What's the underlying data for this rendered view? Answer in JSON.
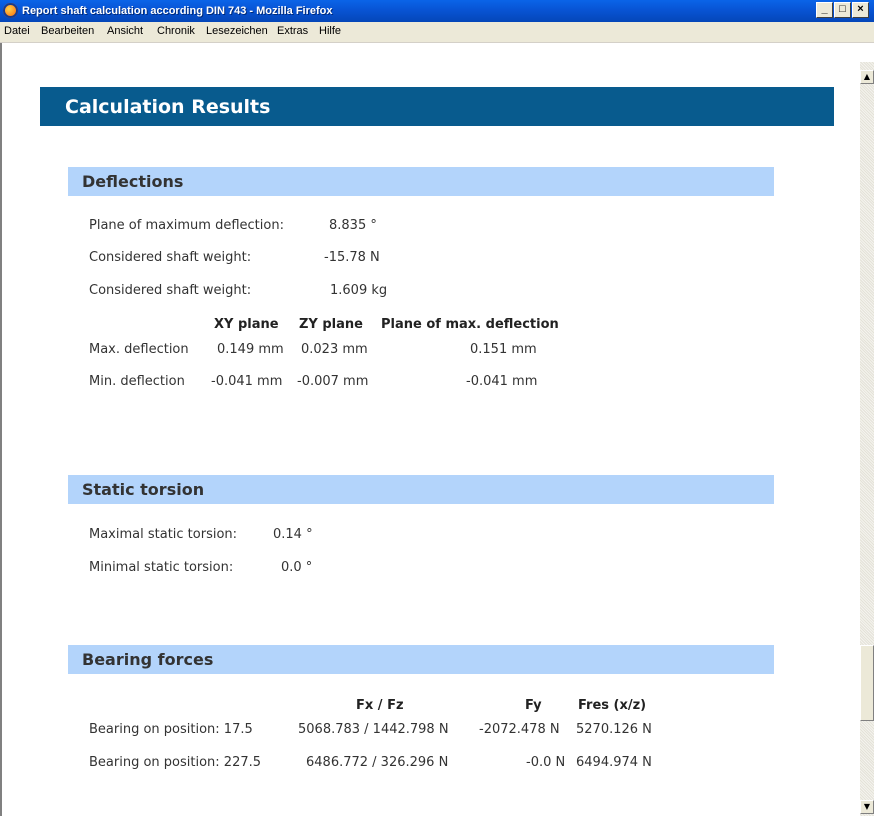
{
  "window": {
    "title": "Report shaft calculation according DIN 743 - Mozilla Firefox",
    "minimize_label": "_",
    "maximize_label": "□",
    "close_label": "×"
  },
  "menu": {
    "items": [
      "Datei",
      "Bearbeiten",
      "Ansicht",
      "Chronik",
      "Lesezeichen",
      "Extras",
      "Hilfe"
    ]
  },
  "scrollbar": {
    "up_label": "▲",
    "down_label": "▼"
  },
  "page": {
    "title": "Calculation Results"
  },
  "deflections": {
    "title": "Deflections",
    "rows": [
      {
        "label": "Plane of maximum deflection:",
        "value": "8.835 °"
      },
      {
        "label": "Considered shaft weight:",
        "value": "-15.78 N"
      },
      {
        "label": "Considered shaft weight:",
        "value": "1.609 kg"
      }
    ],
    "table": {
      "headers": [
        "XY plane",
        "ZY plane",
        "Plane of max. deflection"
      ],
      "rows": [
        {
          "label": "Max. deflection",
          "xy": "0.149 mm",
          "zy": "0.023 mm",
          "max": "0.151 mm"
        },
        {
          "label": "Min. deflection",
          "xy": "-0.041 mm",
          "zy": "-0.007 mm",
          "max": "-0.041 mm"
        }
      ]
    }
  },
  "static_torsion": {
    "title": "Static torsion",
    "rows": [
      {
        "label": "Maximal static torsion:",
        "value": "0.14 °"
      },
      {
        "label": "Minimal static torsion:",
        "value": "0.0 °"
      }
    ]
  },
  "bearing_forces": {
    "title": "Bearing forces",
    "headers": [
      "Fx / Fz",
      "Fy",
      "Fres (x/z)"
    ],
    "rows": [
      {
        "label": "Bearing on position: 17.5",
        "fxfz": "5068.783 / 1442.798 N",
        "fy": "-2072.478 N",
        "fres": "5270.126 N"
      },
      {
        "label": "Bearing on position: 227.5",
        "fxfz": "6486.772 / 326.296 N",
        "fy": "-0.0 N",
        "fres": "6494.974 N"
      }
    ]
  },
  "colors": {
    "header_bg": "#085b8e",
    "section_bg": "#b3d4fb",
    "titlebar": "#0854d4"
  }
}
